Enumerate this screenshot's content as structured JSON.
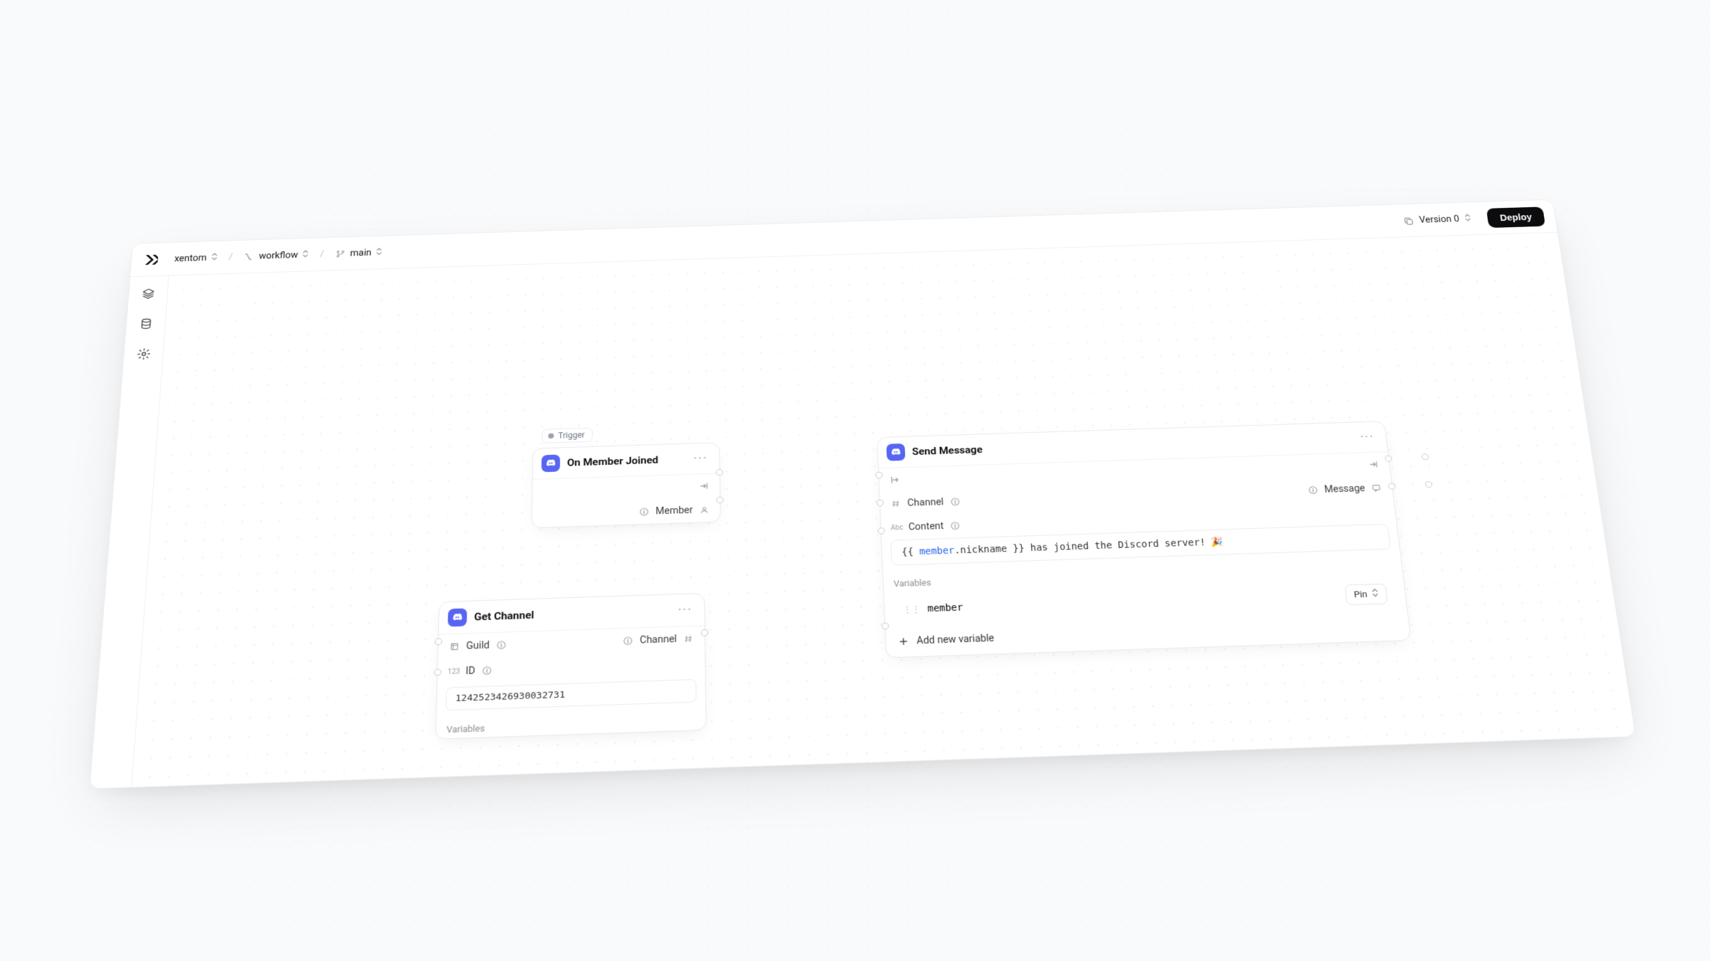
{
  "breadcrumb": {
    "org": "xentom",
    "workflow": "workflow",
    "branch": "main"
  },
  "header": {
    "version_label": "Version 0",
    "deploy_label": "Deploy"
  },
  "nodes": {
    "on_member_joined": {
      "tag": "Trigger",
      "title": "On Member Joined",
      "output_member": "Member"
    },
    "get_channel": {
      "title": "Get Channel",
      "input_guild": "Guild",
      "output_channel": "Channel",
      "input_id": "ID",
      "id_value": "1242523426930032731",
      "variables_label": "Variables"
    },
    "send_message": {
      "title": "Send Message",
      "input_channel": "Channel",
      "output_message": "Message",
      "input_content": "Content",
      "content_prefix": "{{ ",
      "content_token": "member",
      "content_rest": ".nickname }} has joined the Discord server! 🎉",
      "variables_label": "Variables",
      "var_member_name": "member",
      "pin_label": "Pin",
      "add_variable_label": "Add new variable"
    }
  }
}
